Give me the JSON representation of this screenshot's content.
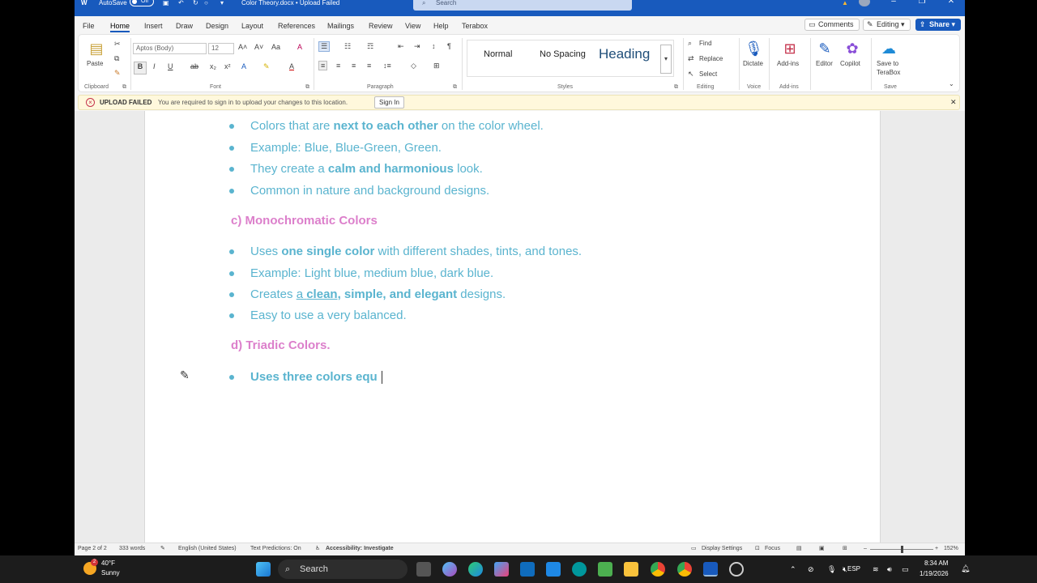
{
  "window": {
    "autosave_label": "AutoSave",
    "autosave_state": "Off",
    "title": "Color Theory.docx • Upload Failed",
    "search_placeholder": "Search"
  },
  "menu": {
    "tabs": [
      "File",
      "Home",
      "Insert",
      "Draw",
      "Design",
      "Layout",
      "References",
      "Mailings",
      "Review",
      "View",
      "Help",
      "Terabox"
    ],
    "active_tab": "Home",
    "comments": "Comments",
    "editing": "Editing",
    "share": "Share"
  },
  "ribbon": {
    "clipboard": {
      "paste": "Paste",
      "label": "Clipboard"
    },
    "font": {
      "name": "Aptos (Body)",
      "size": "12",
      "label": "Font"
    },
    "paragraph": {
      "label": "Paragraph"
    },
    "styles": {
      "normal": "Normal",
      "no_spacing": "No Spacing",
      "heading": "Heading",
      "label": "Styles"
    },
    "editing": {
      "find": "Find",
      "replace": "Replace",
      "select": "Select",
      "label": "Editing"
    },
    "voice": {
      "dictate": "Dictate",
      "label": "Voice"
    },
    "addins": {
      "addins": "Add-ins",
      "label": "Add-ins"
    },
    "editor": "Editor",
    "copilot": "Copilot",
    "save": {
      "save_to": "Save to",
      "terabox": "TeraBox",
      "label": "Save"
    }
  },
  "message_bar": {
    "title": "UPLOAD FAILED",
    "text": "You are required to sign in to upload your changes to this location.",
    "button": "Sign In"
  },
  "document": {
    "section_b_bullets": [
      {
        "pre": "Colors that are ",
        "bold": "next to each other",
        "post": " on the color wheel."
      },
      {
        "pre": "Example: Blue, Blue-Green, Green.",
        "bold": "",
        "post": ""
      },
      {
        "pre": "They create a ",
        "bold": "calm and harmonious",
        "post": " look."
      },
      {
        "pre": "Common in nature and background designs.",
        "bold": "",
        "post": ""
      }
    ],
    "heading_c": "c) Monochromatic Colors",
    "section_c_bullets": [
      {
        "pre": "Uses ",
        "bold": "one single color",
        "post": " with different shades, tints, and tones."
      },
      {
        "pre": "Example: Light blue, medium blue, dark blue.",
        "bold": "",
        "post": ""
      },
      {
        "pre": "Creates ",
        "u1": "a ",
        "ubold": "clean",
        "bold": ", simple, and elegant",
        "post": " designs."
      },
      {
        "pre": "Easy to use a very balanced.",
        "bold": "",
        "post": ""
      }
    ],
    "heading_d": "d) Triadic Colors.",
    "section_d_bullet": "Uses three colors equ"
  },
  "status": {
    "page": "Page 2 of 2",
    "words": "333 words",
    "language": "English (United States)",
    "predictions": "Text Predictions: On",
    "accessibility": "Accessibility: Investigate",
    "display": "Display Settings",
    "focus": "Focus",
    "zoom": "152%"
  },
  "taskbar": {
    "weather_temp": "40°F",
    "weather_desc": "Sunny",
    "weather_badge": "2",
    "search": "Search",
    "lang": "ESP",
    "time": "8:34 AM",
    "date": "1/19/2026"
  }
}
